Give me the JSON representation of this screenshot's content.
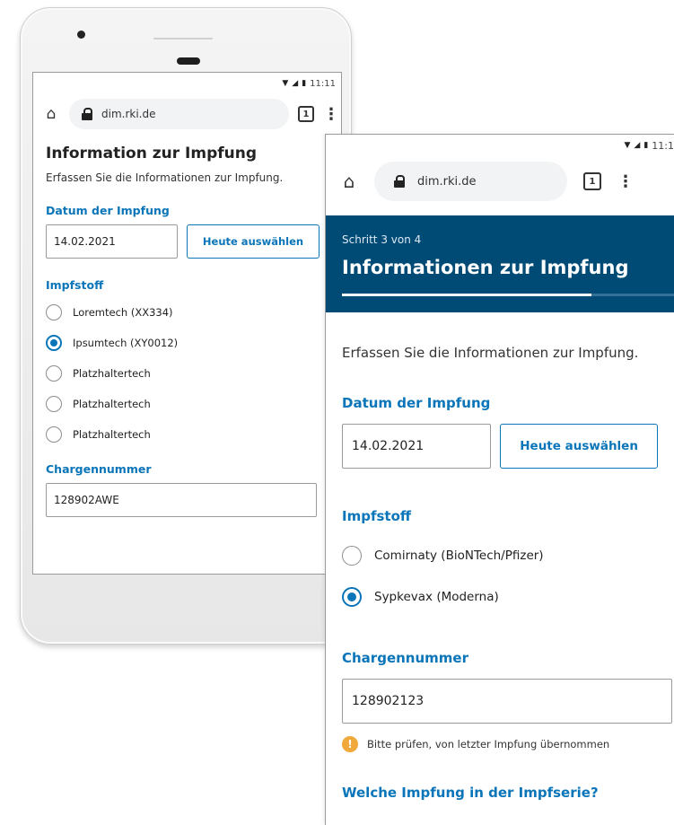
{
  "back_phone": {
    "status": {
      "time": "11:11"
    },
    "browser": {
      "url": "dim.rki.de",
      "tab_count": "1"
    },
    "title": "Information zur Impfung",
    "subtitle": "Erfassen Sie die Informationen zur Impfung.",
    "date_label": "Datum der Impfung",
    "date_value": "14.02.2021",
    "today_button": "Heute auswählen",
    "vaccine_label": "Impfstoff",
    "vaccines": [
      {
        "label": "Loremtech (XX334)",
        "checked": false
      },
      {
        "label": "Ipsumtech (XY0012)",
        "checked": true
      },
      {
        "label": "Platzhaltertech",
        "checked": false
      },
      {
        "label": "Platzhaltertech",
        "checked": false
      },
      {
        "label": "Platzhaltertech",
        "checked": false
      }
    ],
    "batch_label": "Chargennummer",
    "batch_value": "128902AWE"
  },
  "front_screen": {
    "status": {
      "time": "11:1"
    },
    "browser": {
      "url": "dim.rki.de",
      "tab_count": "1"
    },
    "step_label": "Schritt 3 von 4",
    "step_title": "Informationen zur Impfung",
    "step_progress": 0.75,
    "subtitle": "Erfassen Sie die Informationen zur Impfung.",
    "date_label": "Datum der Impfung",
    "date_value": "14.02.2021",
    "today_button": "Heute auswählen",
    "vaccine_label": "Impfstoff",
    "vaccines": [
      {
        "label": "Comirnaty (BioNTech/Pfizer)",
        "checked": false
      },
      {
        "label": "Sypkevax (Moderna)",
        "checked": true
      }
    ],
    "batch_label": "Chargennummer",
    "batch_value": "128902123",
    "batch_hint": "Bitte prüfen, von letzter Impfung übernommen",
    "series_label": "Welche Impfung in der Impfserie?"
  },
  "colors": {
    "accent_blue": "#0a75b8",
    "header_navy": "#004b76",
    "warning_orange": "#f2a93b"
  },
  "icons": {
    "home": "home-icon",
    "lock": "lock-icon",
    "tabs": "tabs-icon",
    "menu": "menu-icon",
    "warning": "warning-icon"
  }
}
